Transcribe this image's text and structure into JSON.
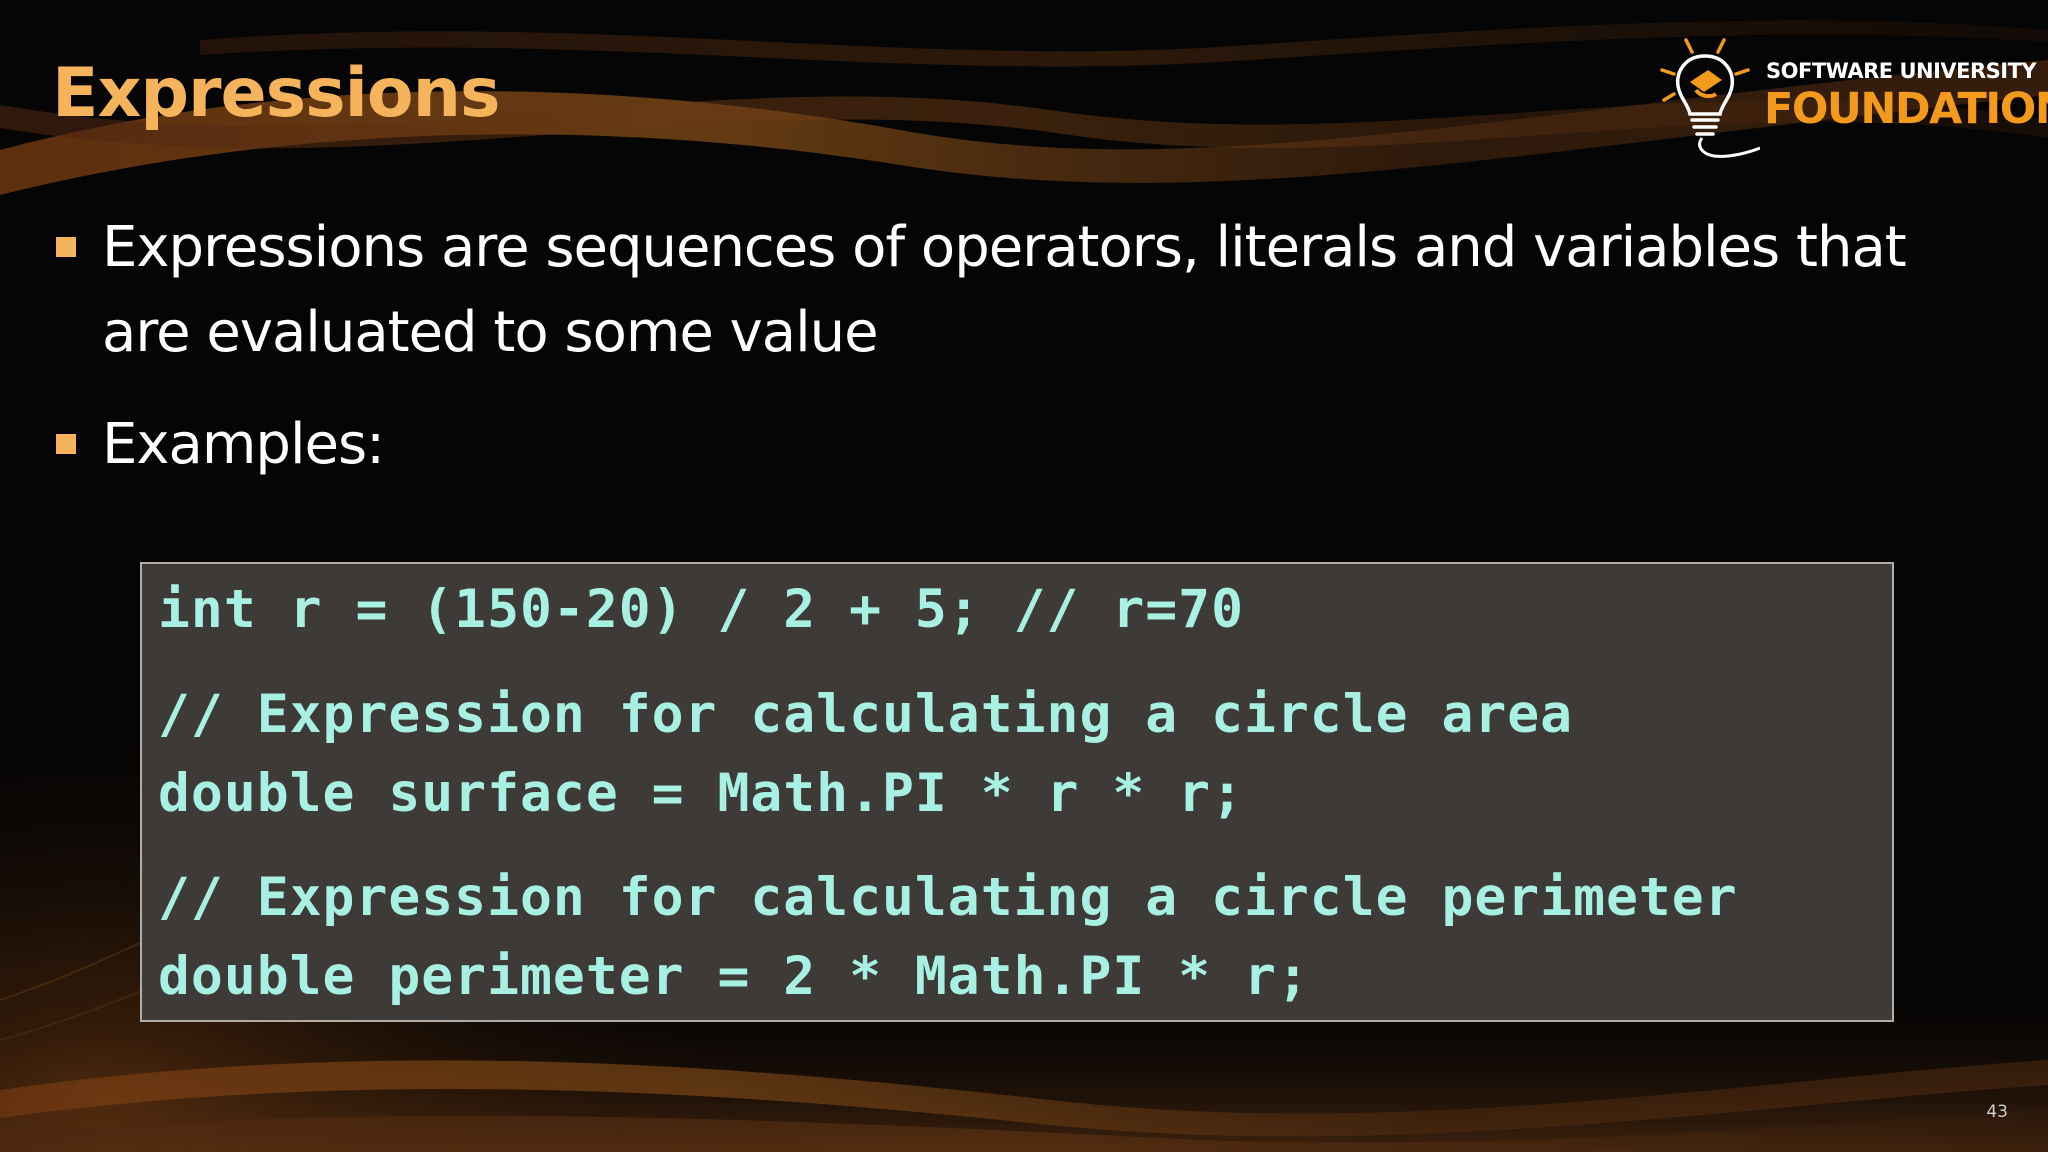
{
  "slide": {
    "title": "Expressions",
    "logo": {
      "line1": "SOFTWARE UNIVERSITY",
      "line2": "FOUNDATION",
      "icon": "lightbulb-logo-icon"
    },
    "bullets": [
      {
        "text": "Expressions are sequences of operators, literals and variables that are evaluated to some value"
      },
      {
        "text": "Examples:"
      }
    ],
    "code": {
      "lines": [
        "int r = (150-20) / 2 + 5; // r=70",
        "// Expression for calculating a circle area",
        "double surface = Math.PI * r * r;",
        "// Expression for calculating a circle perimeter",
        "double perimeter = 2 * Math.PI * r;"
      ]
    },
    "page_number": "43"
  },
  "colors": {
    "title": "#f5b45c",
    "bullet_marker": "#f5b45c",
    "body_text": "#ffffff",
    "code_text": "#a8f0e2",
    "code_background": "#3d3a37",
    "code_border": "#b2ada6",
    "logo_accent": "#f39a1d",
    "background": "#060505"
  }
}
